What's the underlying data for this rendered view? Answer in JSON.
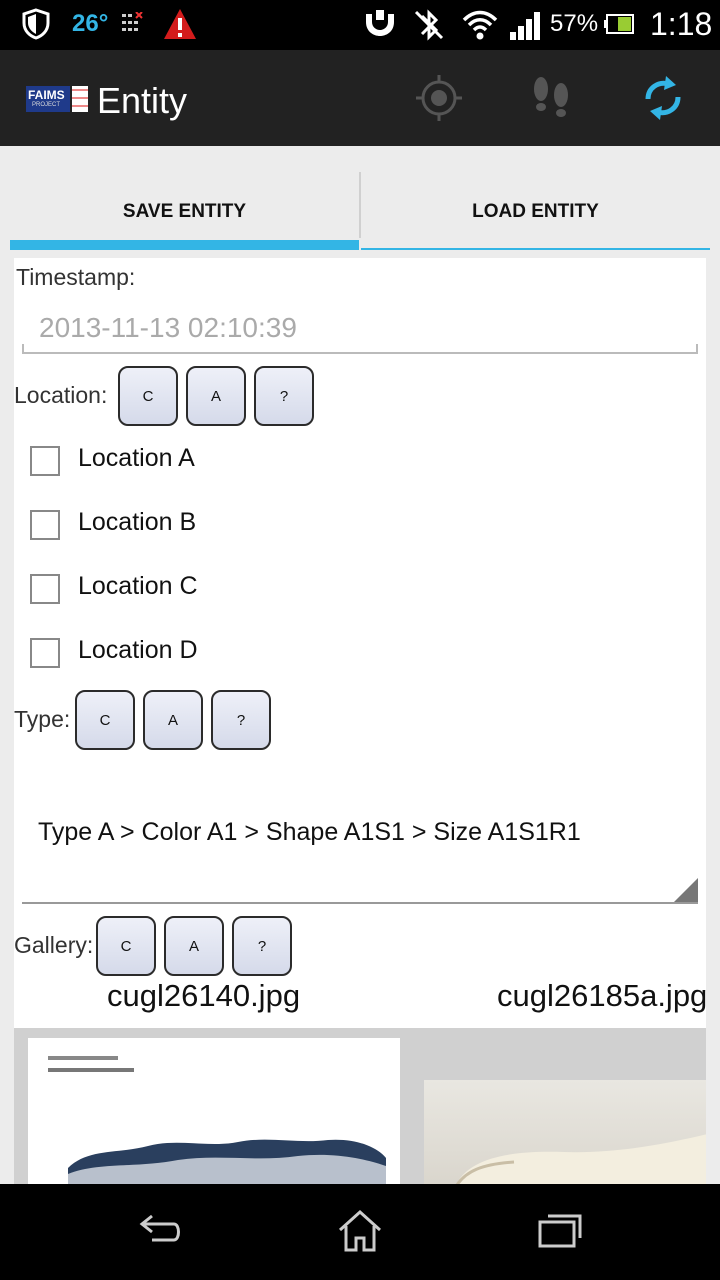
{
  "status_bar": {
    "temperature": "26°",
    "battery_percent": "57%",
    "battery_level": 0.57,
    "time": "1:18"
  },
  "action_bar": {
    "logo_text": "FAIMS",
    "logo_subtext": "PROJECT",
    "title": "Entity",
    "icons": [
      "gps-target-icon",
      "footsteps-icon",
      "sync-icon"
    ]
  },
  "tabs": [
    {
      "label": "SAVE ENTITY",
      "selected": true
    },
    {
      "label": "LOAD ENTITY",
      "selected": false
    }
  ],
  "form": {
    "timestamp_label": "Timestamp:",
    "timestamp_value": "2013-11-13 02:10:39",
    "location_label": "Location:",
    "location_buttons": [
      "C",
      "A",
      "?"
    ],
    "location_options": [
      "Location A",
      "Location B",
      "Location C",
      "Location D"
    ],
    "type_label": "Type:",
    "type_buttons": [
      "C",
      "A",
      "?"
    ],
    "type_value": "Type A > Color A1 > Shape A1S1 > Size A1S1R1",
    "gallery_label": "Gallery:",
    "gallery_buttons": [
      "C",
      "A",
      "?"
    ],
    "gallery_images": [
      "cugl26140.jpg",
      "cugl26185a.jpg"
    ]
  },
  "colors": {
    "accent": "#33b5e5",
    "action_bar_bg": "#222222",
    "button_fill": "#dde1ee"
  },
  "nav_bar": {
    "icons": [
      "back-icon",
      "home-icon",
      "recent-apps-icon"
    ]
  }
}
